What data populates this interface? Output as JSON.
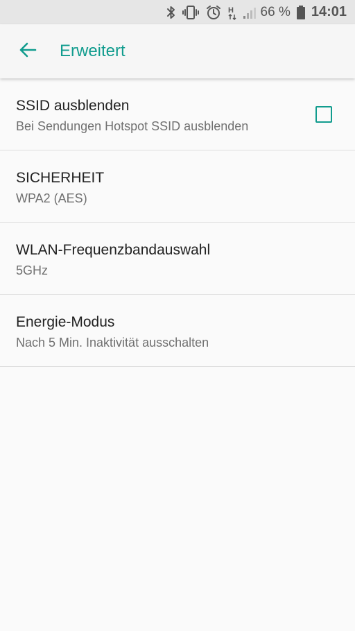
{
  "status_bar": {
    "battery_percent": "66 %",
    "time": "14:01",
    "icons": [
      "bluetooth-icon",
      "vibrate-icon",
      "alarm-icon",
      "hspa-icon",
      "signal-icon",
      "battery-icon"
    ],
    "network_type": "H"
  },
  "header": {
    "title": "Erweitert",
    "back_icon": "arrow-back-icon"
  },
  "settings": [
    {
      "title": "SSID ausblenden",
      "subtitle": "Bei Sendungen Hotspot SSID ausblenden",
      "checked": false
    },
    {
      "title": "SICHERHEIT",
      "subtitle": "WPA2 (AES)"
    },
    {
      "title": "WLAN-Frequenzbandauswahl",
      "subtitle": "5GHz"
    },
    {
      "title": "Energie-Modus",
      "subtitle": "Nach 5 Min. Inaktivität ausschalten"
    }
  ],
  "colors": {
    "accent": "#119c8e",
    "background": "#fafafa",
    "status_bar": "#e6e6e6"
  }
}
